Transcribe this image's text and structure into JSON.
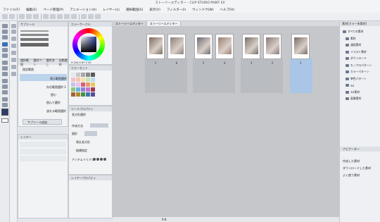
{
  "window": {
    "title": "ストーリーエディター - CLIP STUDIO PAINT EX"
  },
  "menu": [
    "ファイル(F)",
    "編集(E)",
    "ページ管理(P)",
    "アニメーション(A)",
    "レイヤー(L)",
    "選択範囲(S)",
    "表示(V)",
    "フィルター(I)",
    "ウィンドウ(W)",
    "ヘルプ(H)"
  ],
  "tabs": [
    {
      "label": "ストーリーエディター"
    },
    {
      "label": "ストーリーエディター"
    }
  ],
  "pages": [
    {
      "num": "1",
      "color": "#7d6a5c"
    },
    {
      "num": "6",
      "color": "#8c7f7a"
    },
    {
      "num": "5",
      "color": "#6f6a73"
    },
    {
      "num": "4",
      "color": "#9a7f70"
    },
    {
      "num": "3",
      "color": "#766f68"
    },
    {
      "num": "2",
      "color": "#88797a"
    },
    {
      "num": "1",
      "color": "#776c65"
    }
  ],
  "left_panels": {
    "subtool_title": "サブツール",
    "select_tab": "選択範囲",
    "tool_items": [
      "選択ペン",
      "選択消し",
      "自動選択"
    ],
    "preset_items": [
      "指定範囲",
      "表示範囲選択",
      "存在範囲選択 2",
      "囲む",
      "囲んで選択",
      "塗れる範囲選択"
    ],
    "add_button": "サブツール追加",
    "layer_title": "レイヤー",
    "layer_prop_title": "レイヤープロパティ"
  },
  "color_panel": {
    "title": "カラーサークル",
    "hsv_values": "H 244  S 67  V 29",
    "main_color": "#2c3d6b",
    "sub_color": "#ffffff"
  },
  "color_set": {
    "title": "カラーセット",
    "colors": [
      "#e8e8e8",
      "#c8c8c8",
      "#a8a8a8",
      "#888888",
      "#5a5a5a",
      "#f3c2cb",
      "#f1c8ad",
      "#f5e1a9",
      "#c8e3b6",
      "#bad9ef",
      "#c9c2ea",
      "#e7c3e8",
      "#d85f7e",
      "#e59a70",
      "#e8c763",
      "#8cc97a",
      "#6cb3df",
      "#8f7fd3",
      "#c173c7",
      "#9e3a52",
      "#a8603a",
      "#a88d2f",
      "#4f8e44",
      "#3b7aa6",
      "#5a4d99"
    ]
  },
  "tool_property": {
    "title": "ツールプロパティ",
    "name": "長方形選択",
    "option1": "作成方法",
    "option2": "図形",
    "option3": "角丸長方形",
    "option4": "縦横指定",
    "option5": "アンチエイリアス"
  },
  "right_panel": {
    "title": "素材[カラー系素材]",
    "root": "すべての素材",
    "items": [
      "素材",
      "漫画素材",
      "イラスト素材",
      "ダウンロード",
      "モノクロパターン",
      "カラーパターン",
      "単色パターン",
      "3D",
      "3D素材",
      "画像素材"
    ],
    "bottom_title": "ナビゲーター",
    "bottom_items": [
      "作成した素材",
      "ダウンロードした素材",
      "よく使う素材"
    ]
  },
  "status": {
    "zoom": "9.8"
  }
}
